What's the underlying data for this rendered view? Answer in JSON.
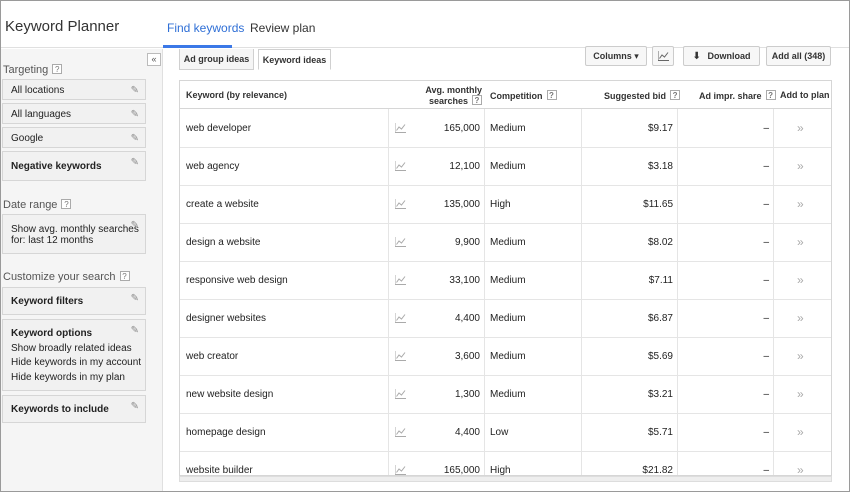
{
  "header": {
    "app_title": "Keyword Planner",
    "tabs": [
      {
        "label": "Find keywords",
        "active": true
      },
      {
        "label": "Review plan",
        "active": false
      }
    ]
  },
  "sidebar": {
    "collapse_label": "«",
    "targeting_label": "Targeting",
    "targeting_items": [
      "All locations",
      "All languages",
      "Google"
    ],
    "negative_keywords": "Negative keywords",
    "date_range_label": "Date range",
    "date_range_line1": "Show avg. monthly searches",
    "date_range_line2": "for: last 12 months",
    "customize_label": "Customize your search",
    "keyword_filters": "Keyword filters",
    "keyword_options_title": "Keyword options",
    "keyword_options": [
      "Show broadly related ideas",
      "Hide keywords in my account",
      "Hide keywords in my plan"
    ],
    "keywords_to_include": "Keywords to include",
    "help_glyph": "?"
  },
  "main": {
    "subtabs": [
      {
        "label": "Ad group ideas",
        "active": false
      },
      {
        "label": "Keyword ideas",
        "active": true
      }
    ],
    "toolbar": {
      "columns": "Columns ▾",
      "download": "Download",
      "add_all": "Add all (348)"
    },
    "columns": {
      "keyword": "Keyword (by relevance)",
      "avg_line1": "Avg. monthly",
      "avg_line2": "searches",
      "competition": "Competition",
      "suggested_bid": "Suggested bid",
      "ad_impr_share": "Ad impr. share",
      "add_to_plan": "Add to plan"
    },
    "rows": [
      {
        "keyword": "web developer",
        "searches": "165,000",
        "competition": "Medium",
        "bid": "$9.17",
        "share": "–"
      },
      {
        "keyword": "web agency",
        "searches": "12,100",
        "competition": "Medium",
        "bid": "$3.18",
        "share": "–"
      },
      {
        "keyword": "create a website",
        "searches": "135,000",
        "competition": "High",
        "bid": "$11.65",
        "share": "–"
      },
      {
        "keyword": "design a website",
        "searches": "9,900",
        "competition": "Medium",
        "bid": "$8.02",
        "share": "–"
      },
      {
        "keyword": "responsive web design",
        "searches": "33,100",
        "competition": "Medium",
        "bid": "$7.11",
        "share": "–"
      },
      {
        "keyword": "designer websites",
        "searches": "4,400",
        "competition": "Medium",
        "bid": "$6.87",
        "share": "–"
      },
      {
        "keyword": "web creator",
        "searches": "3,600",
        "competition": "Medium",
        "bid": "$5.69",
        "share": "–"
      },
      {
        "keyword": "new website design",
        "searches": "1,300",
        "competition": "Medium",
        "bid": "$3.21",
        "share": "–"
      },
      {
        "keyword": "homepage design",
        "searches": "4,400",
        "competition": "Low",
        "bid": "$5.71",
        "share": "–"
      },
      {
        "keyword": "website builder",
        "searches": "165,000",
        "competition": "High",
        "bid": "$21.82",
        "share": "–"
      }
    ],
    "add_glyph": "»"
  },
  "colors": {
    "accent": "#3b78e7",
    "active_tab_text": "#2f6fd6"
  }
}
